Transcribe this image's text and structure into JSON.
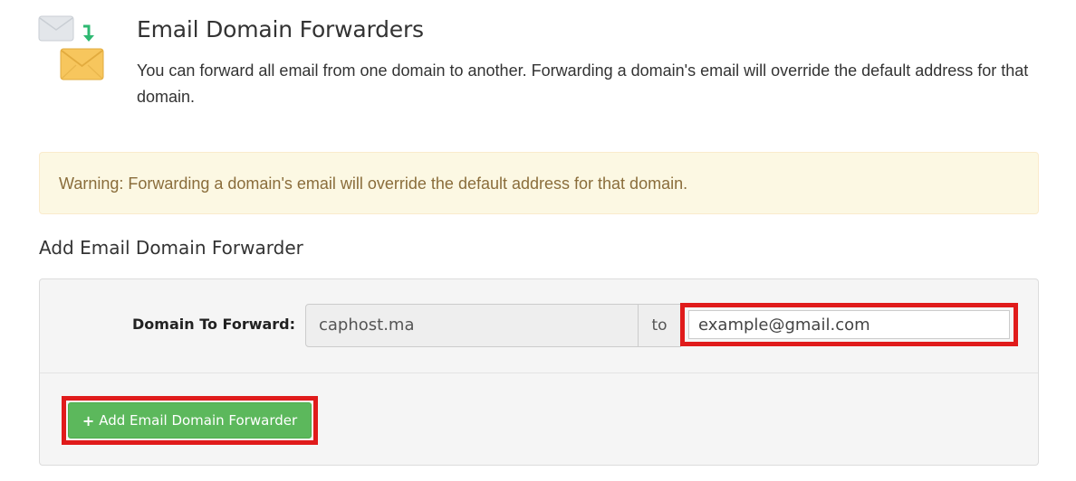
{
  "header": {
    "title": "Email Domain Forwarders",
    "description": "You can forward all email from one domain to another. Forwarding a domain's email will override the default address for that domain.",
    "icon": "email-forward-icon"
  },
  "warning": {
    "text": "Warning: Forwarding a domain's email will override the default address for that domain."
  },
  "form": {
    "section_title": "Add Email Domain Forwarder",
    "domain_label": "Domain To Forward:",
    "domain_value": "caphost.ma",
    "to_label": "to",
    "destination_value": "example@gmail.com",
    "submit_icon": "+",
    "submit_label": "Add Email Domain Forwarder"
  },
  "colors": {
    "highlight": "#e01b1b",
    "button": "#5cb85c",
    "warning_bg": "#fcf8e3",
    "warning_text": "#8a6d3b"
  }
}
